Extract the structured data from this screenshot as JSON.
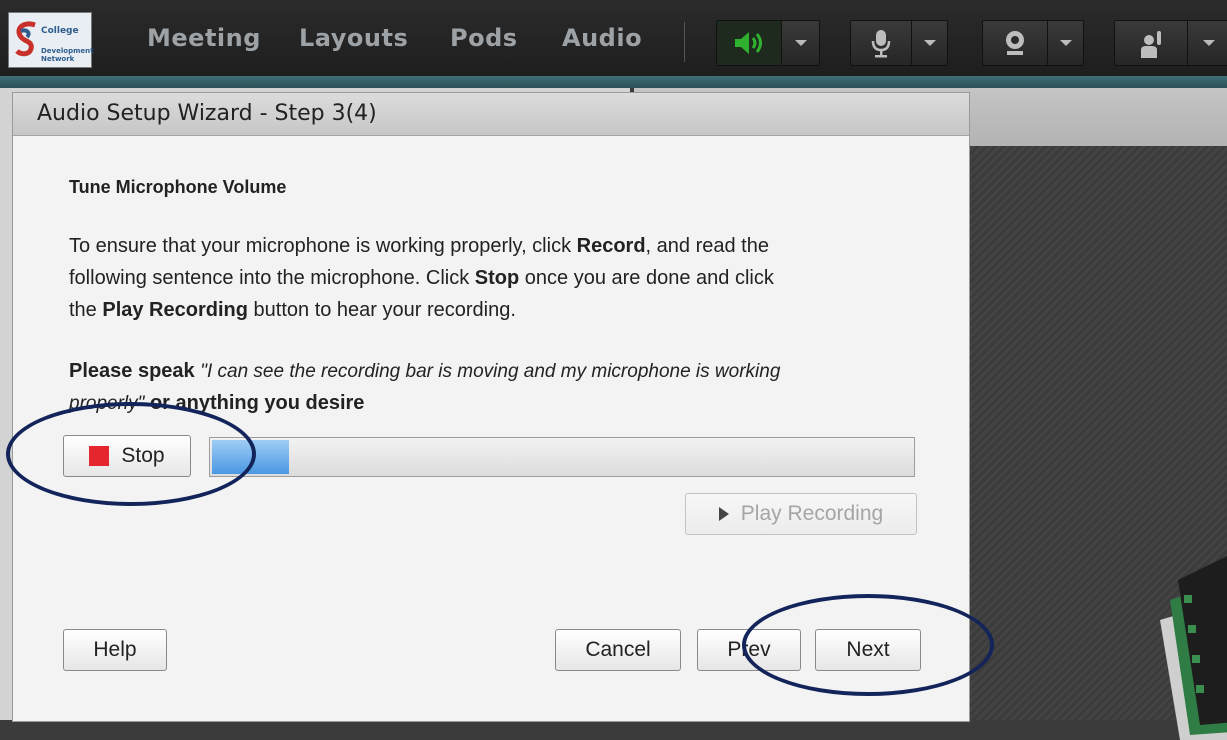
{
  "topbar": {
    "logo": {
      "line1": "College",
      "line2": "Development",
      "line3": "Network"
    },
    "menu": [
      "Meeting",
      "Layouts",
      "Pods",
      "Audio"
    ],
    "colors": {
      "speaker_active": "#2fb12f",
      "accent": "#3e6f77"
    }
  },
  "dialog": {
    "title": "Audio Setup Wizard - Step 3(4)",
    "heading": "Tune Microphone Volume",
    "instructions": {
      "line1_pre": "To ensure that your microphone is working properly, click ",
      "line1_bold": "Record",
      "line1_post": ", and read the",
      "line2_pre": "following sentence into the microphone. Click ",
      "line2_bold": "Stop",
      "line2_post": " once you are done and click",
      "line3_pre": "the ",
      "line3_bold": "Play Recording",
      "line3_post": " button to hear your recording."
    },
    "prompt": {
      "bold_pre": "Please speak ",
      "quote_line1": "\"I can see the recording bar is moving and my microphone is working",
      "quote_line2": "properly\"",
      "bold_post": " or anything you desire"
    },
    "stop_label": "Stop",
    "level_percent": 11,
    "play_label": "Play Recording",
    "buttons": {
      "help": "Help",
      "cancel": "Cancel",
      "prev": "Prev",
      "next": "Next"
    }
  }
}
